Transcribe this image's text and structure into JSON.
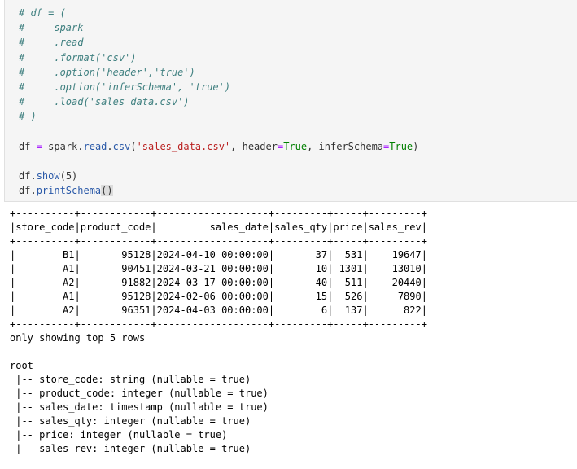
{
  "code_cell": {
    "comment_lines": [
      "# df = (",
      "#     spark",
      "#     .read",
      "#     .format('csv')",
      "#     .option('header','true')",
      "#     .option('inferSchema', 'true')",
      "#     .load('sales_data.csv')",
      "# )"
    ],
    "read_line": {
      "var": "df",
      "eq": " = ",
      "obj": "spark",
      "dot1": ".",
      "read": "read",
      "dot2": ".",
      "csv": "csv",
      "open": "(",
      "file": "'sales_data.csv'",
      "sep1": ", header",
      "eq2": "=",
      "true1": "True",
      "sep2": ", inferSchema",
      "eq3": "=",
      "true2": "True",
      "close": ")"
    },
    "show_line": {
      "var": "df",
      "dot": ".",
      "method": "show",
      "args": "(5)"
    },
    "schema_line": {
      "var": "df",
      "dot": ".",
      "method": "printSchema",
      "args": "()"
    }
  },
  "output": {
    "table_lines": [
      "+----------+------------+-------------------+---------+-----+---------+",
      "|store_code|product_code|         sales_date|sales_qty|price|sales_rev|",
      "+----------+------------+-------------------+---------+-----+---------+",
      "|        B1|       95128|2024-04-10 00:00:00|       37|  531|    19647|",
      "|        A1|       90451|2024-03-21 00:00:00|       10| 1301|    13010|",
      "|        A2|       91882|2024-03-17 00:00:00|       40|  511|    20440|",
      "|        A1|       95128|2024-02-06 00:00:00|       15|  526|     7890|",
      "|        A2|       96351|2024-04-03 00:00:00|        6|  137|      822|",
      "+----------+------------+-------------------+---------+-----+---------+"
    ],
    "note": "only showing top 5 rows",
    "schema_root": "root",
    "schema_lines": [
      " |-- store_code: string (nullable = true)",
      " |-- product_code: integer (nullable = true)",
      " |-- sales_date: timestamp (nullable = true)",
      " |-- sales_qty: integer (nullable = true)",
      " |-- price: integer (nullable = true)",
      " |-- sales_rev: integer (nullable = true)"
    ]
  }
}
